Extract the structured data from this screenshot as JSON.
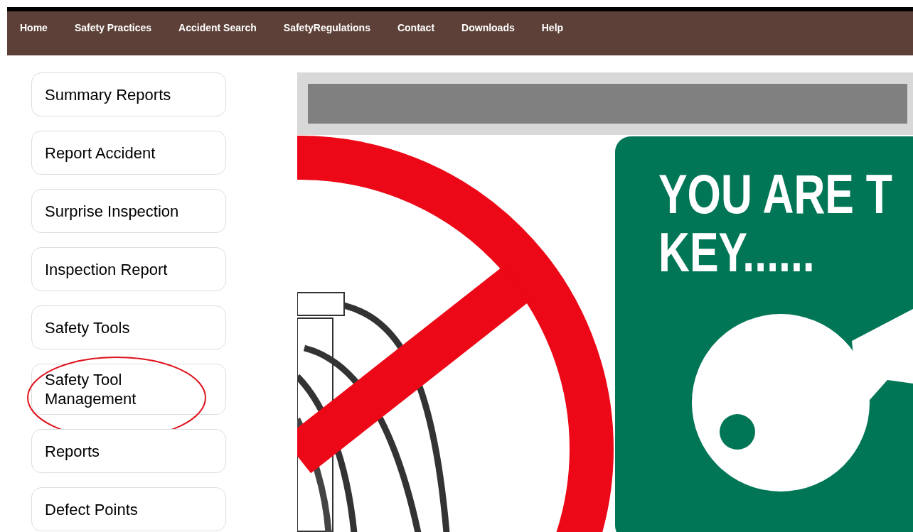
{
  "nav": {
    "items": [
      {
        "label": "Home"
      },
      {
        "label": "Safety Practices"
      },
      {
        "label": "Accident Search"
      },
      {
        "label": "SafetyRegulations"
      },
      {
        "label": "Contact"
      },
      {
        "label": "Downloads"
      },
      {
        "label": "Help"
      }
    ]
  },
  "sidebar": {
    "items": [
      {
        "label": "Summary Reports",
        "circled": false
      },
      {
        "label": "Report Accident",
        "circled": false
      },
      {
        "label": "Surprise Inspection",
        "circled": false
      },
      {
        "label": "Inspection Report",
        "circled": false
      },
      {
        "label": "Safety Tools",
        "circled": false
      },
      {
        "label": "Safety Tool Management",
        "circled": true
      },
      {
        "label": "Reports",
        "circled": false
      },
      {
        "label": "Defect Points",
        "circled": false
      }
    ]
  },
  "banner": {
    "sign_lines": [
      "YOU ARE T",
      "KEY......"
    ]
  }
}
